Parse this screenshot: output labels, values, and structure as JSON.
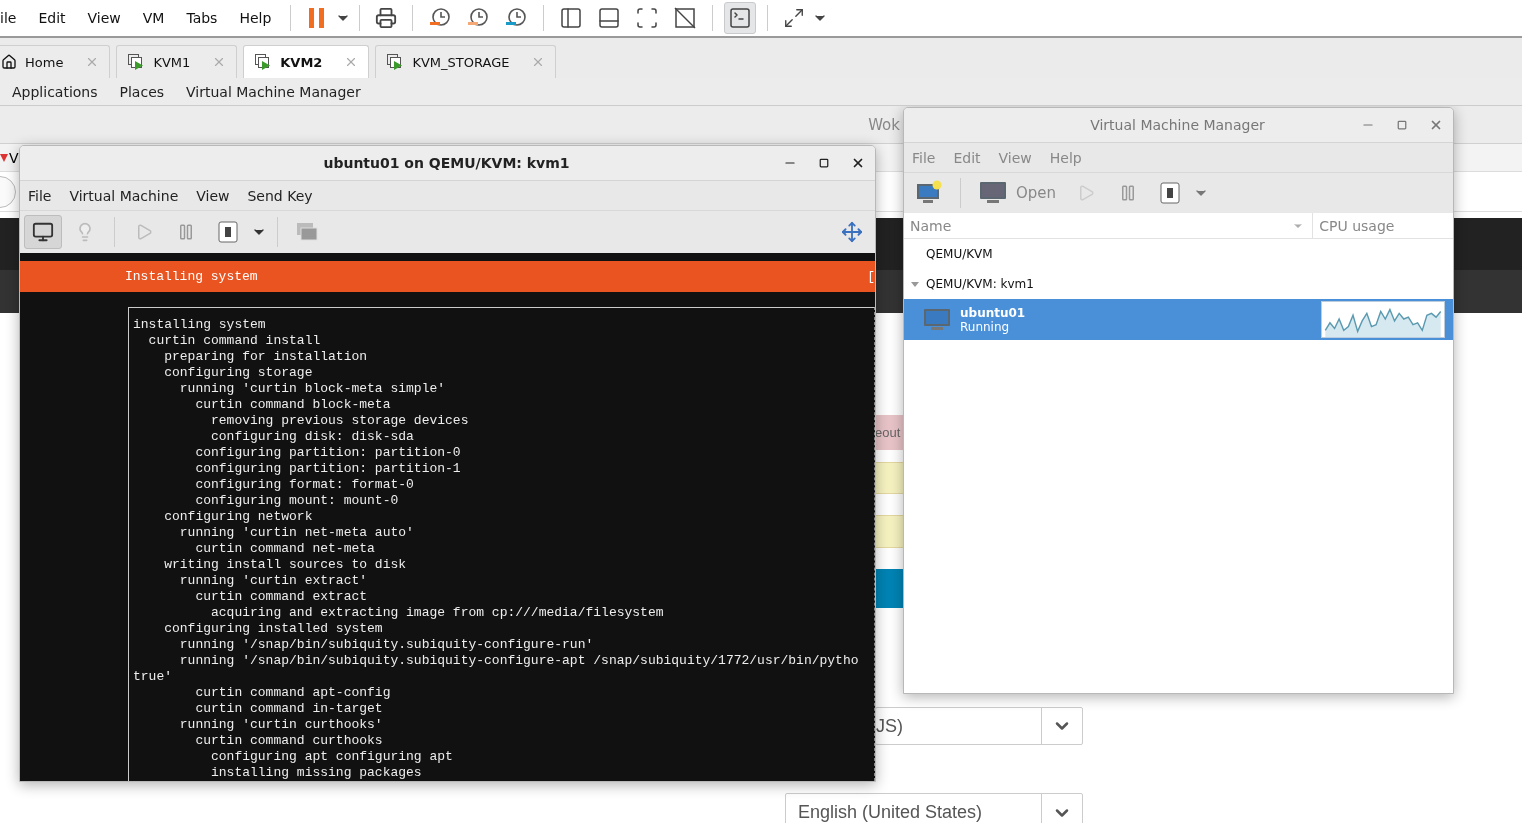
{
  "app_menu": [
    "ile",
    "Edit",
    "View",
    "VM",
    "Tabs",
    "Help"
  ],
  "toolbar": {
    "vm_running": true,
    "console_active": true
  },
  "tabs": [
    {
      "label": "Home",
      "kind": "home",
      "selected": false
    },
    {
      "label": "KVM1",
      "kind": "vm",
      "selected": false
    },
    {
      "label": "KVM2",
      "kind": "vm",
      "selected": true
    },
    {
      "label": "KVM_STORAGE",
      "kind": "vm",
      "selected": false
    }
  ],
  "panel": [
    "Applications",
    "Places",
    "Virtual Machine Manager"
  ],
  "background_page": {
    "title": "Wok",
    "tab_letter": "V",
    "bars": [
      {
        "kind": "danger",
        "text": "eout"
      },
      {
        "kind": "warning"
      },
      {
        "kind": "warning"
      },
      {
        "kind": "info"
      }
    ],
    "selects": [
      "JS)",
      "English (United States)"
    ]
  },
  "console_window": {
    "title": "ubuntu01 on QEMU/KVM: kvm1",
    "menu": [
      "File",
      "Virtual Machine",
      "View",
      "Send Key"
    ],
    "view_buttons": [
      {
        "kind": "console",
        "selected": true
      },
      {
        "kind": "details",
        "selected": false
      }
    ],
    "status_bar": "Installing system",
    "status_bracket": "[",
    "lines": [
      "installing system",
      "  curtin command install",
      "    preparing for installation",
      "    configuring storage",
      "      running 'curtin block-meta simple'",
      "        curtin command block-meta",
      "          removing previous storage devices",
      "          configuring disk: disk-sda",
      "        configuring partition: partition-0",
      "        configuring partition: partition-1",
      "        configuring format: format-0",
      "        configuring mount: mount-0",
      "    configuring network",
      "      running 'curtin net-meta auto'",
      "        curtin command net-meta",
      "    writing install sources to disk",
      "      running 'curtin extract'",
      "        curtin command extract",
      "          acquiring and extracting image from cp:///media/filesystem",
      "    configuring installed system",
      "      running '/snap/bin/subiquity.subiquity-configure-run'",
      "      running '/snap/bin/subiquity.subiquity-configure-apt /snap/subiquity/1772/usr/bin/pytho",
      "true'",
      "        curtin command apt-config",
      "        curtin command in-target",
      "      running 'curtin curthooks'",
      "        curtin command curthooks",
      "          configuring apt configuring apt",
      "          installing missing packages"
    ]
  },
  "manager_window": {
    "title": "Virtual Machine Manager",
    "menu": [
      "File",
      "Edit",
      "View",
      "Help"
    ],
    "open_button": "Open",
    "columns": [
      "Name",
      "CPU usage"
    ],
    "connections": [
      {
        "name": "QEMU/KVM"
      },
      {
        "name": "QEMU/KVM: kvm1",
        "expanded": true,
        "children": [
          {
            "name": "ubuntu01",
            "status": "Running",
            "selected": true
          }
        ]
      }
    ]
  }
}
